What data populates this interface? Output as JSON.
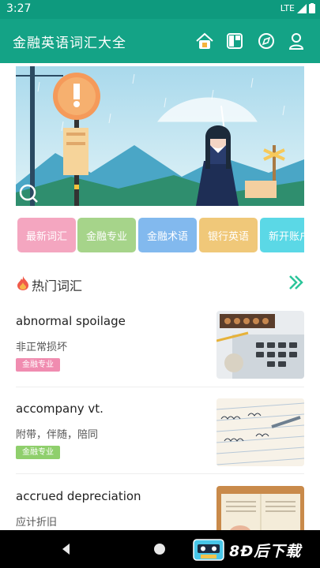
{
  "status_bar": {
    "time": "3:27",
    "network": "LTE"
  },
  "app_bar": {
    "title": "金融英语词汇大全",
    "icons": [
      "home-icon",
      "grid-icon",
      "compass-icon",
      "profile-icon"
    ]
  },
  "categories": [
    {
      "label": "最新词汇",
      "color": "#f4a6c0"
    },
    {
      "label": "金融专业",
      "color": "#a6d48a"
    },
    {
      "label": "金融术语",
      "color": "#82b9ee"
    },
    {
      "label": "银行英语",
      "color": "#f0c879"
    },
    {
      "label": "新开账户",
      "color": "#5bd8e6"
    }
  ],
  "hot_section": {
    "title": "热门词汇",
    "accent": "#2bc59a"
  },
  "words": [
    {
      "word": "abnormal spoilage",
      "meaning": "非正常损坏",
      "tag": "金融专业",
      "tag_color": "#f08cb0"
    },
    {
      "word": "accompany vt.",
      "meaning": "附带，伴随，陪同",
      "tag": "金融专业",
      "tag_color": "#8fcf6c"
    },
    {
      "word": "accrued depreciation",
      "meaning": "应计折旧",
      "tag": "",
      "tag_color": ""
    }
  ],
  "watermark": {
    "text": "8Ð后下载"
  }
}
